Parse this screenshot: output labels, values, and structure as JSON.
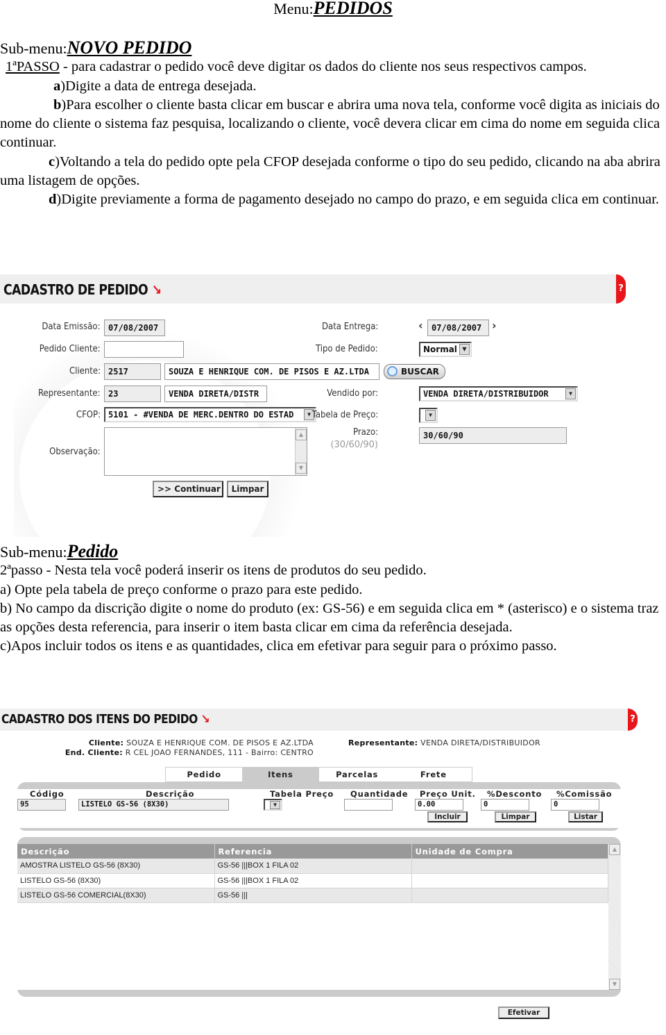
{
  "doc": {
    "menu_prefix": "Menu:",
    "menu_name": "PEDIDOS",
    "section1": {
      "submenu_prefix": "Sub-menu:",
      "submenu_name": "NOVO PEDIDO",
      "step_label": "1ªPASSO",
      "step_text": " - para cadastrar o pedido você deve digitar os dados do cliente nos seus respectivos campos.",
      "items": [
        {
          "letter": "a",
          "text": ")Digite a data de entrega desejada."
        },
        {
          "letter": "b",
          "text": ")Para escolher o cliente basta clicar em buscar e abrira uma nova tela, conforme você digita as iniciais do nome do cliente o sistema faz pesquisa, localizando o cliente, você devera clicar em cima do nome em seguida clica continuar."
        },
        {
          "letter": "c",
          "text": ")Voltando a tela do pedido opte pela CFOP desejada conforme o tipo do seu pedido, clicando na aba abrira uma listagem de opções."
        },
        {
          "letter": "d",
          "text": ")Digite previamente a forma de pagamento desejado no campo do prazo, e em seguida clica em continuar."
        }
      ]
    },
    "section2": {
      "submenu_prefix": "Sub-menu:",
      "submenu_name": "Pedido",
      "lines": [
        "2ªpasso - Nesta tela você poderá inserir os itens de produtos do seu pedido.",
        "a) Opte pela tabela de preço conforme o prazo para este pedido.",
        "b) No campo da discrição digite o nome do produto (ex: GS-56) e em seguida clica em * (asterisco) e o sistema traz as opções desta referencia, para inserir o item basta clicar em cima da referência desejada.",
        "c)Apos incluir todos os itens e as quantidades, clica em efetivar para seguir para o próximo passo."
      ]
    }
  },
  "cadastro_pedido": {
    "title": "CADASTRO DE PEDIDO",
    "arrow_icon": "↘",
    "help_icon": "?",
    "colors": {
      "accent": "#e8161b",
      "header_bg": "#efefef"
    },
    "labels": {
      "data_emissao": "Data Emissão:",
      "pedido_cliente": "Pedido Cliente:",
      "cliente": "Cliente:",
      "representante": "Representante:",
      "cfop": "CFOP:",
      "observacao": "Observação:",
      "data_entrega": "Data Entrega:",
      "tipo_pedido": "Tipo de Pedido:",
      "vendido_por": "Vendido por:",
      "tabela_preco": "Tabela de Preço:",
      "prazo": "Prazo:",
      "prazo_hint": "(30/60/90)"
    },
    "values": {
      "data_emissao": "07/08/2007",
      "pedido_cliente": "",
      "cliente_codigo": "2517",
      "cliente_nome": "SOUZA E HENRIQUE COM. DE PISOS E AZ.LTDA",
      "representante_codigo": "23",
      "representante_nome": "VENDA DIRETA/DISTR",
      "cfop": "5101 - #VENDA DE MERC.DENTRO DO ESTAD",
      "observacao": "",
      "data_entrega": "07/08/2007",
      "tipo_pedido": "Normal",
      "vendido_por": "VENDA DIRETA/DISTRIBUIDOR",
      "tabela_preco": "",
      "prazo": "30/60/90"
    },
    "nav_prev": "‹",
    "nav_next": "›",
    "buscar_label": "BUSCAR",
    "continuar_label": ">> Continuar",
    "limpar_label": "Limpar",
    "dropdown_glyph": "▼",
    "scroll_up": "▲",
    "scroll_down": "▼"
  },
  "cadastro_itens": {
    "title": "CADASTRO DOS ITENS DO PEDIDO",
    "arrow_icon": "↘",
    "help_icon": "?",
    "cliente_label": "Cliente:",
    "cliente_value": "SOUZA E HENRIQUE COM. DE PISOS E AZ.LTDA",
    "end_label": "End. Cliente:",
    "end_value": "R CEL JOAO FERNANDES, 111 - Bairro: CENTRO",
    "rep_label": "Representante:",
    "rep_value": "VENDA DIRETA/DISTRIBUIDOR",
    "tabs": [
      {
        "label": "Pedido",
        "active": false
      },
      {
        "label": "Itens",
        "active": true
      },
      {
        "label": "Parcelas",
        "active": false
      },
      {
        "label": "Frete",
        "active": false
      }
    ],
    "form": {
      "codigo_label": "Código",
      "codigo_value": "95",
      "descricao_label": "Descrição",
      "descricao_value": "LISTELO GS-56 (8X30)",
      "tabela_label": "Tabela Preço",
      "tabela_value": "",
      "quantidade_label": "Quantidade",
      "quantidade_value": "",
      "preco_label": "Preço Unit.",
      "preco_value": "0.00",
      "desconto_label": "%Desconto",
      "desconto_value": "0",
      "comissao_label": "%Comissão",
      "comissao_value": "0",
      "incluir_label": "Incluir",
      "limpar_label": "Limpar",
      "listar_label": "Listar"
    },
    "grid": {
      "columns": [
        "Descrição",
        "Referencia",
        "Unidade de Compra"
      ],
      "rows": [
        [
          "AMOSTRA LISTELO GS-56 (8X30)",
          "GS-56 |||BOX 1 FILA 02",
          ""
        ],
        [
          "LISTELO GS-56 (8X30)",
          "GS-56 |||BOX 1 FILA 02",
          ""
        ],
        [
          "LISTELO GS-56 COMERCIAL(8X30)",
          "GS-56 |||",
          ""
        ]
      ]
    },
    "efetivar_label": "Efetivar"
  }
}
